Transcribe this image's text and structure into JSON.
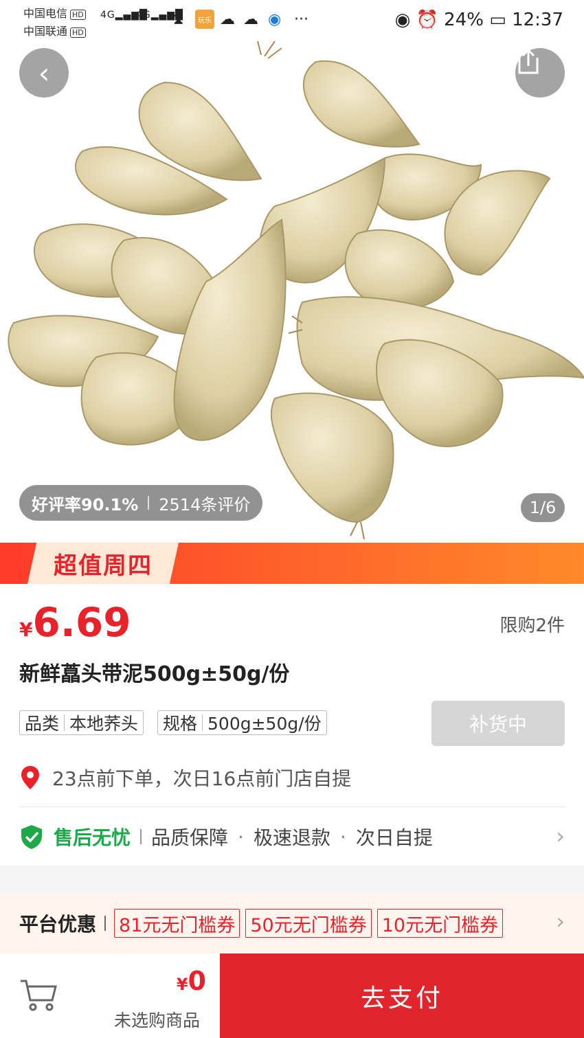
{
  "status_bar": {
    "carrier1": "中国电信",
    "carrier2": "中国联通",
    "hd": "HD",
    "network": "4G",
    "app_badge": "玩乐",
    "more": "···",
    "battery": "24%",
    "time": "12:37"
  },
  "hero": {
    "rating_label": "好评率90.1%",
    "review_count": "2514条评价",
    "page_indicator": "1/6"
  },
  "promo": {
    "tag": "超值周四"
  },
  "product": {
    "currency": "¥",
    "price": "6.69",
    "limit": "限购2件",
    "title": "新鲜藠头带泥500g±50g/份",
    "specs": [
      {
        "key": "品类",
        "value": "本地荞头"
      },
      {
        "key": "规格",
        "value": "500g±50g/份"
      }
    ],
    "restock_label": "补货中",
    "pickup_text": "23点前下单，次日16点前门店自提"
  },
  "after_sales": {
    "label": "售后无忧",
    "items": [
      "品质保障",
      "极速退款",
      "次日自提"
    ]
  },
  "coupons": {
    "label": "平台优惠",
    "items": [
      "81元无门槛券",
      "50元无门槛券",
      "10元无门槛券"
    ]
  },
  "bottom": {
    "currency": "¥",
    "total": "0",
    "unselected": "未选购商品",
    "pay_label": "去支付"
  },
  "colors": {
    "accent": "#e8222a",
    "green": "#1fa84a",
    "pay": "#e0262c"
  }
}
